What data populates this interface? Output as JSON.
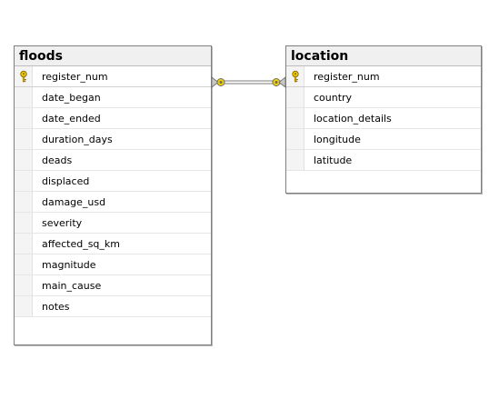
{
  "tables": {
    "floods": {
      "title": "floods",
      "columns": [
        {
          "name": "register_num",
          "key": true
        },
        {
          "name": "date_began",
          "key": false
        },
        {
          "name": "date_ended",
          "key": false
        },
        {
          "name": "duration_days",
          "key": false
        },
        {
          "name": "deads",
          "key": false
        },
        {
          "name": "displaced",
          "key": false
        },
        {
          "name": "damage_usd",
          "key": false
        },
        {
          "name": "severity",
          "key": false
        },
        {
          "name": "affected_sq_km",
          "key": false
        },
        {
          "name": "magnitude",
          "key": false
        },
        {
          "name": "main_cause",
          "key": false
        },
        {
          "name": "notes",
          "key": false
        }
      ]
    },
    "location": {
      "title": "location",
      "columns": [
        {
          "name": "register_num",
          "key": true
        },
        {
          "name": "country",
          "key": false
        },
        {
          "name": "location_details",
          "key": false
        },
        {
          "name": "longitude",
          "key": false
        },
        {
          "name": "latitude",
          "key": false
        }
      ]
    }
  },
  "colors": {
    "key_icon": "#e8c200",
    "relationship_line": "#7a7a7a",
    "connector_end": "#f2d100"
  },
  "icons": {
    "primary_key": "key-icon",
    "relationship_end": "relationship-end-icon"
  }
}
